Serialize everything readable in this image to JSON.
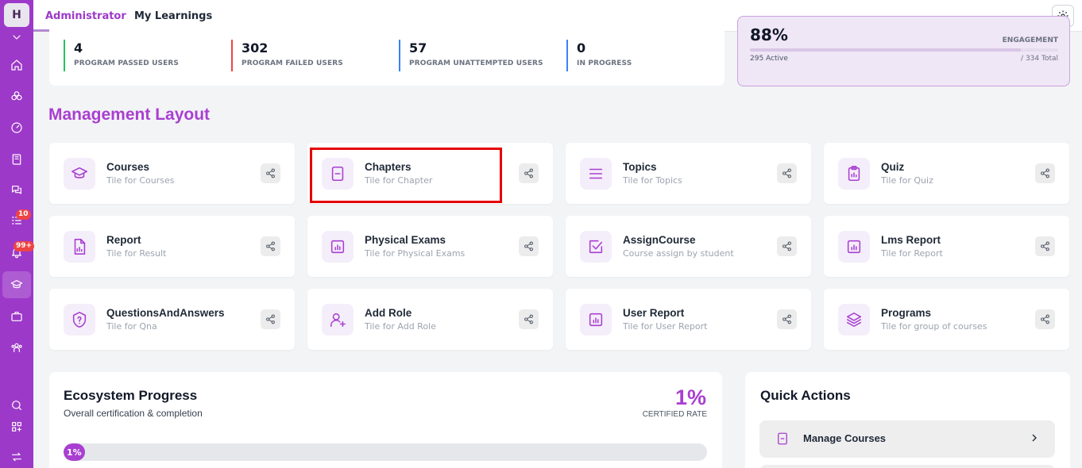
{
  "app": {
    "logo_letter": "H"
  },
  "sidebar": {
    "badges": {
      "tasks": "10",
      "notifications": "99+"
    }
  },
  "tabs": {
    "admin": "Administrator",
    "my_learnings": "My Learnings"
  },
  "stats": [
    {
      "value": "4",
      "label": "PROGRAM PASSED USERS",
      "color": "#22c55e"
    },
    {
      "value": "302",
      "label": "PROGRAM FAILED USERS",
      "color": "#ef4444"
    },
    {
      "value": "57",
      "label": "PROGRAM UNATTEMPTED USERS",
      "color": "#3b82f6"
    },
    {
      "value": "0",
      "label": "IN PROGRESS",
      "color": "#3b82f6"
    }
  ],
  "engagement": {
    "percent": "88%",
    "label": "ENGAGEMENT",
    "active": "295 Active",
    "total": "/ 334 Total",
    "fill_fraction": 0.88
  },
  "section_title": "Management Layout",
  "tiles": [
    {
      "title": "Courses",
      "subtitle": "Tile for Courses",
      "icon": "graduation-cap-icon"
    },
    {
      "title": "Chapters",
      "subtitle": "Tile for Chapter",
      "icon": "book-icon"
    },
    {
      "title": "Topics",
      "subtitle": "Tile for Topics",
      "icon": "list-icon"
    },
    {
      "title": "Quiz",
      "subtitle": "Tile for Quiz",
      "icon": "clipboard-icon"
    },
    {
      "title": "Report",
      "subtitle": "Tile for Result",
      "icon": "file-chart-icon"
    },
    {
      "title": "Physical Exams",
      "subtitle": "Tile for Physical Exams",
      "icon": "bar-chart-icon"
    },
    {
      "title": "AssignCourse",
      "subtitle": "Course assign by student",
      "icon": "check-square-icon"
    },
    {
      "title": "Lms Report",
      "subtitle": "Tile for Report",
      "icon": "bar-chart-icon"
    },
    {
      "title": "QuestionsAndAnswers",
      "subtitle": "Tile for Qna",
      "icon": "question-shield-icon"
    },
    {
      "title": "Add Role",
      "subtitle": "Tile for Add Role",
      "icon": "user-plus-icon"
    },
    {
      "title": "User Report",
      "subtitle": "Tile for User Report",
      "icon": "bar-chart-icon"
    },
    {
      "title": "Programs",
      "subtitle": "Tile for group of courses",
      "icon": "layers-icon"
    }
  ],
  "ecosystem": {
    "title": "Ecosystem Progress",
    "subtitle": "Overall certification & completion",
    "percent": "1%",
    "rate_label": "CERTIFIED RATE",
    "bar_label": "1%",
    "fill_fraction": 0.01
  },
  "quick_actions": {
    "title": "Quick Actions",
    "items": [
      {
        "label": "Manage Courses",
        "icon": "book-icon"
      }
    ]
  },
  "colors": {
    "accent": "#a93fd1",
    "sidebar": "#9d39c9",
    "highlight": "#e60000"
  }
}
